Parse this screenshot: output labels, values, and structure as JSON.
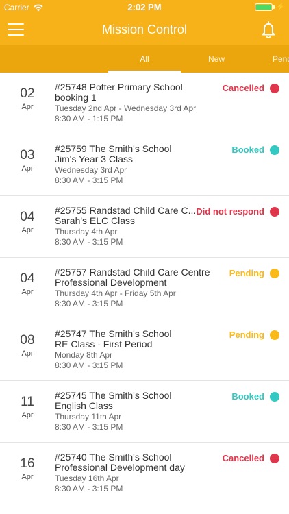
{
  "status_bar": {
    "carrier": "Carrier",
    "time": "2:02 PM"
  },
  "nav": {
    "title": "Mission Control"
  },
  "tabs": [
    {
      "label": "All"
    },
    {
      "label": "New"
    },
    {
      "label": "Pend"
    }
  ],
  "colors": {
    "header": "#F8B219",
    "tabs": "#EAA60C",
    "cancelled": "#E0364B",
    "booked": "#33C9C2",
    "pending": "#F8B919"
  },
  "bookings": [
    {
      "day": "02",
      "month": "Apr",
      "title": "#25748 Potter Primary School",
      "subtitle": "booking 1",
      "dates": "Tuesday 2nd Apr - Wednesday 3rd Apr",
      "time": "8:30 AM - 1:15 PM",
      "status": "Cancelled",
      "status_color": "#E0364B"
    },
    {
      "day": "03",
      "month": "Apr",
      "title": "#25759 The Smith's School",
      "subtitle": "Jim's Year 3 Class",
      "dates": "Wednesday 3rd Apr",
      "time": "8:30 AM - 3:15 PM",
      "status": "Booked",
      "status_color": "#33C9C2"
    },
    {
      "day": "04",
      "month": "Apr",
      "title": "#25755 Randstad Child Care C...",
      "subtitle": "Sarah's ELC Class",
      "dates": "Thursday 4th Apr",
      "time": "8:30 AM - 3:15 PM",
      "status": "Did not respond",
      "status_color": "#E0364B"
    },
    {
      "day": "04",
      "month": "Apr",
      "title": "#25757 Randstad Child Care Centre",
      "subtitle": "Professional Development",
      "dates": "Thursday 4th Apr - Friday 5th Apr",
      "time": "8:30 AM - 3:15 PM",
      "status": "Pending",
      "status_color": "#F8B919"
    },
    {
      "day": "08",
      "month": "Apr",
      "title": "#25747 The Smith's School",
      "subtitle": "RE Class  - First Period",
      "dates": "Monday 8th Apr",
      "time": "8:30 AM - 3:15 PM",
      "status": "Pending",
      "status_color": "#F8B919"
    },
    {
      "day": "11",
      "month": "Apr",
      "title": "#25745 The Smith's School",
      "subtitle": "English Class",
      "dates": "Thursday 11th Apr",
      "time": "8:30 AM - 3:15 PM",
      "status": "Booked",
      "status_color": "#33C9C2"
    },
    {
      "day": "16",
      "month": "Apr",
      "title": "#25740 The Smith's School",
      "subtitle": "Professional Development day",
      "dates": "Tuesday 16th Apr",
      "time": "8:30 AM - 3:15 PM",
      "status": "Cancelled",
      "status_color": "#E0364B"
    }
  ]
}
